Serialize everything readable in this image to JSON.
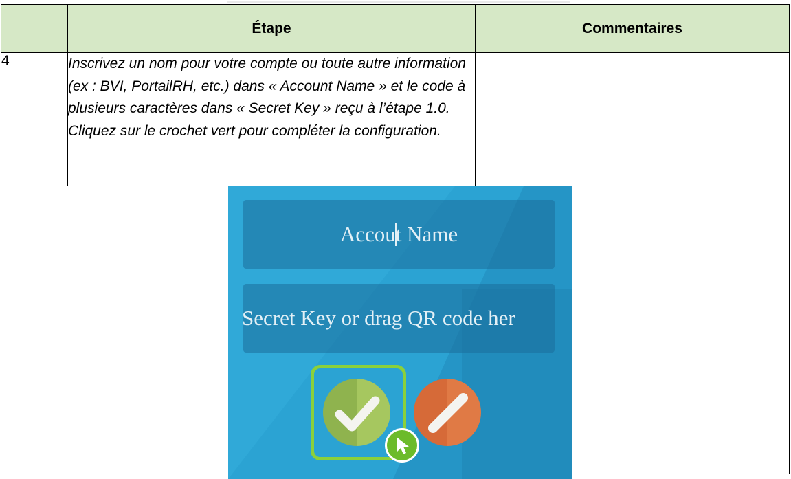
{
  "table": {
    "headers": {
      "number": "",
      "step": "Étape",
      "comments": "Commentaires"
    },
    "row": {
      "number": "4",
      "instruction": "Inscrivez un nom pour votre compte ou toute autre information (ex : BVI, PortailRH, etc.) dans « Account Name » et le code à plusieurs caractères dans « Secret Key » reçu à l’étape 1.0. Cliquez sur le crochet vert pour compléter la configuration.",
      "comments": ""
    }
  },
  "screenshot": {
    "account_name_before_caret": "Accou",
    "account_name_after_caret": "t Name",
    "secret_key_placeholder": "Secret Key or drag QR code her",
    "confirm_icon": "checkmark-icon",
    "cancel_icon": "slash-icon",
    "cursor_icon": "mouse-pointer-icon",
    "colors": {
      "background": "#2ba3d3",
      "field": "#1c6e9b",
      "confirm": "#a6c75f",
      "cancel": "#e07a45",
      "highlight": "#8bd03b",
      "header_fill": "#d6e8c6"
    }
  }
}
